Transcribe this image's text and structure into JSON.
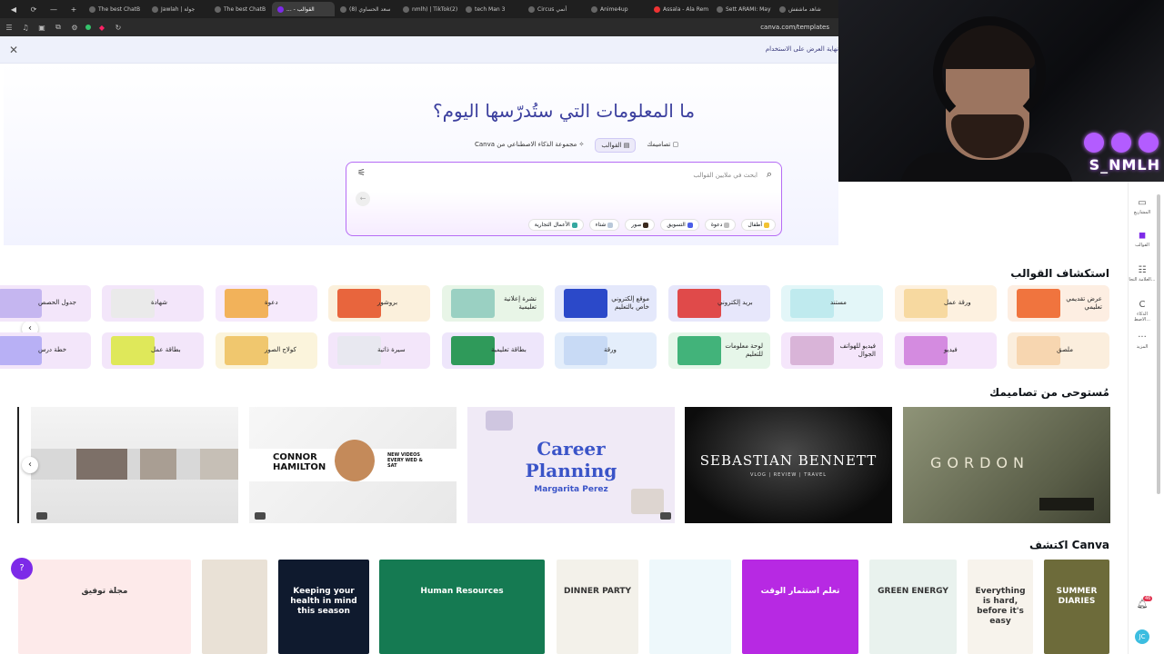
{
  "browser": {
    "tabs": [
      {
        "label": "The best ChatB"
      },
      {
        "label": "جولة | Jawlah"
      },
      {
        "label": "The best ChatB"
      },
      {
        "label": "القوالب - ..."
      },
      {
        "label": "سعد الحساوي (8)"
      },
      {
        "label": "nmlh) | TikTok(2)"
      },
      {
        "label": "tech Man 3"
      },
      {
        "label": "أنمي Circus"
      },
      {
        "label": "Anime4up"
      },
      {
        "label": "Assala - Ala Rem"
      },
      {
        "label": "Sett ARAMI: May"
      },
      {
        "label": "شاهد ماشفش"
      }
    ],
    "url": "canva.com/templates"
  },
  "promo": {
    "text": "نهاية العرض على الاستخدام"
  },
  "webcam": {
    "name": "S_NMLH"
  },
  "hero": {
    "title": "ما المعلومات التي ستُدرّسها اليوم؟",
    "modes": [
      {
        "label": "تصاميمك",
        "active": false
      },
      {
        "label": "القوالب",
        "active": true
      },
      {
        "label": "مجموعة الذكاء الاصطناعي من Canva",
        "active": false
      }
    ],
    "search_placeholder": "ابحث في ملايين القوالب",
    "chips": [
      {
        "label": "أطفال",
        "color": "#f2c232"
      },
      {
        "label": "دعوة",
        "color": "#bdbdbd"
      },
      {
        "label": "التسويق",
        "color": "#4b5ee8"
      },
      {
        "label": "صور",
        "color": "#3b2a1e"
      },
      {
        "label": "شتاء",
        "color": "#b9c8d9"
      },
      {
        "label": "الأعمال التجارية",
        "color": "#35a8a0"
      }
    ]
  },
  "explore_templates": {
    "title": "استكشاف القوالب",
    "row1": [
      {
        "label": "عرض تقديمي تعليمي",
        "bg": "#fdeee2",
        "thumb": "#f0743e"
      },
      {
        "label": "ورقة عمل",
        "bg": "#fdf1e0",
        "thumb": "#f7d9a0"
      },
      {
        "label": "مستند",
        "bg": "#e3f6f8",
        "thumb": "#bfeaee"
      },
      {
        "label": "بريد إلكتروني",
        "bg": "#e7e7fb",
        "thumb": "#e04a4a"
      },
      {
        "label": "موقع إلكتروني خاص بالتعليم",
        "bg": "#e4e8fb",
        "thumb": "#2b49c9"
      },
      {
        "label": "نشرة إعلانية تعليمية",
        "bg": "#e8f5e7",
        "thumb": "#9ad0c2"
      },
      {
        "label": "بروشور",
        "bg": "#fbf0dc",
        "thumb": "#e8653d"
      },
      {
        "label": "دعوة",
        "bg": "#f6eafc",
        "thumb": "#f2b25a"
      },
      {
        "label": "شهادة",
        "bg": "#f3e6fa",
        "thumb": "#eaeaea"
      },
      {
        "label": "جدول الحصص",
        "bg": "#f3e6fa",
        "thumb": "#c5b6f0"
      }
    ],
    "row2": [
      {
        "label": "ملصق",
        "bg": "#fbeedd",
        "thumb": "#f7d6b0"
      },
      {
        "label": "فيديو",
        "bg": "#f5e6fb",
        "thumb": "#d48be0"
      },
      {
        "label": "فيديو للهواتف الجوال",
        "bg": "#f5e6fb",
        "thumb": "#d9b4d8"
      },
      {
        "label": "لوحة معلومات للتعليم",
        "bg": "#e6f6e9",
        "thumb": "#42b37a"
      },
      {
        "label": "ورقة",
        "bg": "#e4eefb",
        "thumb": "#c8daf5"
      },
      {
        "label": "بطاقة تعليمية",
        "bg": "#eee6fb",
        "thumb": "#2f9a5a"
      },
      {
        "label": "سيرة ذاتية",
        "bg": "#f3e6fa",
        "thumb": "#e8e8f0"
      },
      {
        "label": "كولاج الصور",
        "bg": "#fbf4dc",
        "thumb": "#f0c76e"
      },
      {
        "label": "بطاقة عمل",
        "bg": "#f3e6fa",
        "thumb": "#dfe85a"
      },
      {
        "label": "خطة درس",
        "bg": "#f3e6fa",
        "thumb": "#b8b0f5"
      }
    ]
  },
  "inspired": {
    "title": "مُستوحى من تصاميمك",
    "d2": {
      "name1": "CONNOR",
      "name2": "HAMILTON",
      "tag": "NEW VIDEOS EVERY WED & SAT"
    },
    "d3": {
      "line1": "Career",
      "line2": "Planning",
      "sub": "Margarita Perez"
    },
    "d4": {
      "name": "SEBASTIAN BENNETT",
      "sub": "VLOG | REVIEW | TRAVEL"
    },
    "d5": {
      "name": "GORDON"
    }
  },
  "explore_canva": {
    "title": "اكتشف Canva",
    "items": [
      {
        "text": "مجلة توفيق",
        "bg": "#fdeaea"
      },
      {
        "text": "",
        "bg": "#e9e1d6"
      },
      {
        "text": "Keeping your health in mind this season",
        "bg": "#0f1a2e"
      },
      {
        "text": "Human Resources",
        "bg": "#157a52"
      },
      {
        "text": "DINNER PARTY",
        "bg": "#f3f1ea"
      },
      {
        "text": "",
        "bg": "#eef8fb"
      },
      {
        "text": "تعلم استثمار الوقت",
        "bg": "#b729e3"
      },
      {
        "text": "GREEN ENERGY",
        "bg": "#e9f2ee"
      },
      {
        "text": "Everything is hard, before it's easy",
        "bg": "#f7f3ec"
      },
      {
        "text": "SUMMER DIARIES",
        "bg": "#6d6b3a"
      }
    ]
  },
  "sidebar": {
    "items": [
      {
        "label": "المشاريع",
        "icon": "folder-icon",
        "active": false
      },
      {
        "label": "القوالب",
        "icon": "templates-icon",
        "active": true
      },
      {
        "label": "العلامة التجا...",
        "icon": "brand-icon",
        "active": false
      },
      {
        "label": "الذكاء الاصط...",
        "icon": "ai-icon",
        "active": false
      },
      {
        "label": "المزيد",
        "icon": "more-icon",
        "active": false
      }
    ],
    "notification_count": "46"
  }
}
